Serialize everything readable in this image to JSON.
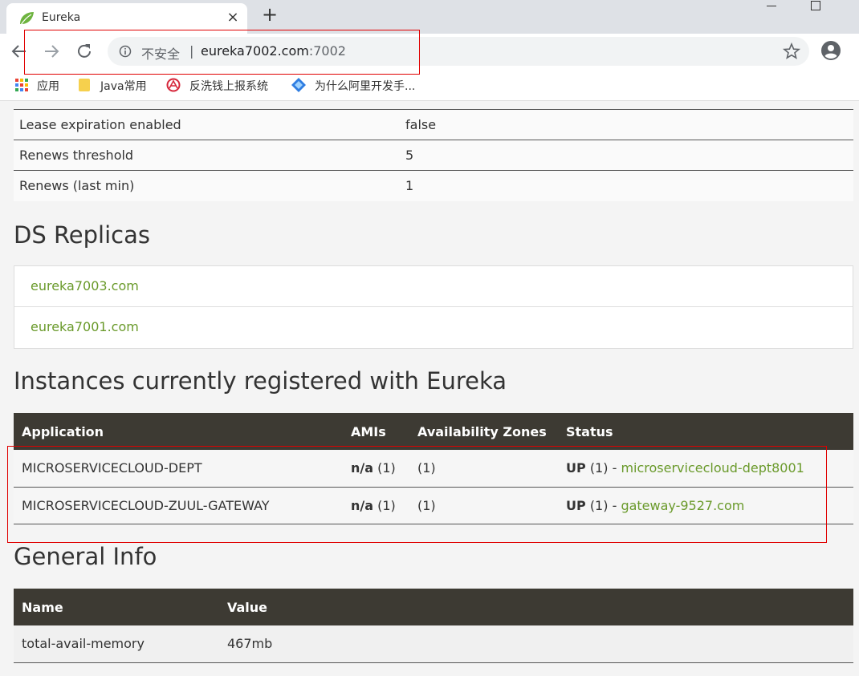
{
  "browser": {
    "tab_title": "Eureka",
    "tab_close": "×",
    "new_tab": "+",
    "insecure_label": "不安全",
    "separator": "|",
    "url_host": "eureka7002.com",
    "url_port": ":7002",
    "icons": [
      "leaf-favicon-icon",
      "back-icon",
      "forward-icon",
      "reload-icon",
      "info-icon",
      "star-icon",
      "profile-icon",
      "minimize-icon",
      "maximize-icon",
      "apps-icon",
      "folder-icon",
      "bookmark-red-icon",
      "bookmark-blue-icon"
    ]
  },
  "bookmarks": {
    "apps": "应用",
    "java": "Java常用",
    "anti_money": "反洗钱上报系统",
    "ali": "为什么阿里开发手..."
  },
  "lease_table": {
    "rows": [
      {
        "key": "Lease expiration enabled",
        "value": "false"
      },
      {
        "key": "Renews threshold",
        "value": "5"
      },
      {
        "key": "Renews (last min)",
        "value": "1"
      }
    ]
  },
  "ds_replicas": {
    "heading": "DS Replicas",
    "items": [
      "eureka7003.com",
      "eureka7001.com"
    ]
  },
  "instances": {
    "heading": "Instances currently registered with Eureka",
    "headers": [
      "Application",
      "AMIs",
      "Availability Zones",
      "Status"
    ],
    "rows": [
      {
        "app": "MICROSERVICECLOUD-DEPT",
        "ami_bold": "n/a",
        "ami_count": "(1)",
        "zones": "(1)",
        "status_bold": "UP",
        "status_count": "(1) -",
        "status_link": "microservicecloud-dept8001"
      },
      {
        "app": "MICROSERVICECLOUD-ZUUL-GATEWAY",
        "ami_bold": "n/a",
        "ami_count": "(1)",
        "zones": "(1)",
        "status_bold": "UP",
        "status_count": "(1) -",
        "status_link": "gateway-9527.com"
      }
    ]
  },
  "general_info": {
    "heading": "General Info",
    "headers": [
      "Name",
      "Value"
    ],
    "rows": [
      {
        "name": "total-avail-memory",
        "value": "467mb"
      }
    ]
  },
  "colors": {
    "link_green": "#6a9a2b",
    "table_header": "#3d3a33",
    "highlight_red": "#e00000"
  }
}
